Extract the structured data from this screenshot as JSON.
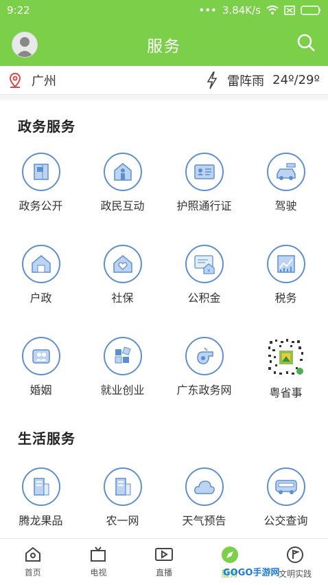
{
  "status_bar": {
    "time": "9:22",
    "network_speed": "3.84K/s"
  },
  "header": {
    "title": "服务"
  },
  "weather": {
    "city": "广州",
    "condition": "雷阵雨",
    "temperature": "24º/29º"
  },
  "sections": {
    "government": {
      "title": "政务服务",
      "items": [
        {
          "label": "政务公开",
          "icon": "flag-document-icon"
        },
        {
          "label": "政民互动",
          "icon": "house-person-icon"
        },
        {
          "label": "护照通行证",
          "icon": "id-card-icon"
        },
        {
          "label": "驾驶",
          "icon": "car-icon"
        },
        {
          "label": "户政",
          "icon": "house-icon"
        },
        {
          "label": "社保",
          "icon": "house-heart-icon"
        },
        {
          "label": "公积金",
          "icon": "fund-house-icon"
        },
        {
          "label": "税务",
          "icon": "chart-icon"
        },
        {
          "label": "婚姻",
          "icon": "couple-icon"
        },
        {
          "label": "就业创业",
          "icon": "blocks-icon"
        },
        {
          "label": "广东政务网",
          "icon": "whistle-icon"
        },
        {
          "label": "粤省事",
          "icon": "qr-code-icon"
        }
      ]
    },
    "life": {
      "title": "生活服务",
      "items": [
        {
          "label": "腾龙果品",
          "icon": "building-icon"
        },
        {
          "label": "农一网",
          "icon": "building-icon"
        },
        {
          "label": "天气预告",
          "icon": "cloud-icon"
        },
        {
          "label": "公交查询",
          "icon": "bus-icon"
        }
      ]
    }
  },
  "bottom_nav": [
    {
      "label": "首页",
      "icon": "home-icon"
    },
    {
      "label": "电视",
      "icon": "tv-icon"
    },
    {
      "label": "直播",
      "icon": "video-icon"
    },
    {
      "label": "服务",
      "icon": "compass-icon"
    },
    {
      "label": "文明实践",
      "icon": "flag-icon"
    }
  ],
  "watermark": "GOGO手游网",
  "colors": {
    "brand_green": "#7ccf48",
    "icon_blue": "#5d8fd0"
  }
}
